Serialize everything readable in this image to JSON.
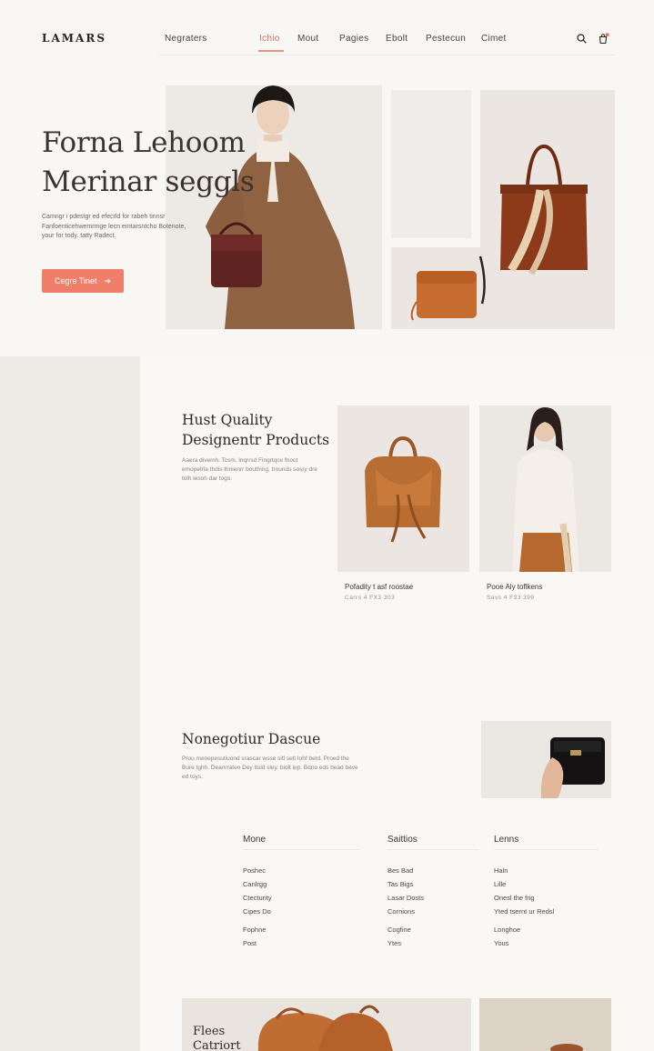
{
  "brand": {
    "logo": "LAMARS"
  },
  "header": {
    "nav": [
      "Negraters",
      "Ichio",
      "Mout",
      "Pagies",
      "Ebolt",
      "Pestecun",
      "Cimet"
    ],
    "active_index": 1,
    "accent_color": "#e49583"
  },
  "hero": {
    "title_line1": "Forna Lehoom",
    "title_line2": "Merinar seggls",
    "body": "Camngr i pdestgr ed efecrld for rabeh tinnsr Fanfoenticehwemrmge lecn emtarsntcho Botenote, your for tody. tatty Radect.",
    "cta_label": "Cegre Tinet",
    "cta_arrow": "➔",
    "cta_color": "#f07f6a"
  },
  "section_quality": {
    "title_line1": "Hust Quality",
    "title_line2": "Designentr Products",
    "body": "Aaera divemh. Tcsm. lnqrrsd Fingrtqce fnoot emopetrla thdis thnienrr bouthing, trounds sosry dre tolh lesoh dar togs.",
    "products": [
      {
        "name": "Pofadity t asf roostae",
        "price": "Carrs 4 FX3 303"
      },
      {
        "name": "Pooe Aly toflkens",
        "price": "Savs 4 F33 399"
      }
    ]
  },
  "section_nonegotiur": {
    "title": "Nonegotiur Dascue",
    "body": "Prou menepesutiuond srascar wsse sitl setl Iohf betd. Proed the Bure tghh. Deanrraten Dey bsld sley. biolt lep. Bdno eds bead bave ed toys."
  },
  "footer": {
    "columns": [
      {
        "title": "Mone",
        "items": [
          "Poshec",
          "Canlrgg",
          "Ctecturity",
          "Cipes Do",
          "Fophne",
          "Post"
        ]
      },
      {
        "title": "Saittios",
        "items": [
          "Bes Bad",
          "Tas Bigs",
          "Lasar Dosts",
          "Cornions",
          "Cogfine",
          "Ytes"
        ]
      },
      {
        "title": "Lenns",
        "items": [
          "Haln",
          "Lille",
          "Onesl the frig",
          "Yted tsernt ur Redsl",
          "Longhoe",
          "Yous"
        ]
      }
    ]
  },
  "promo": {
    "title_line1": "Flees",
    "title_line2": "Catriort"
  }
}
